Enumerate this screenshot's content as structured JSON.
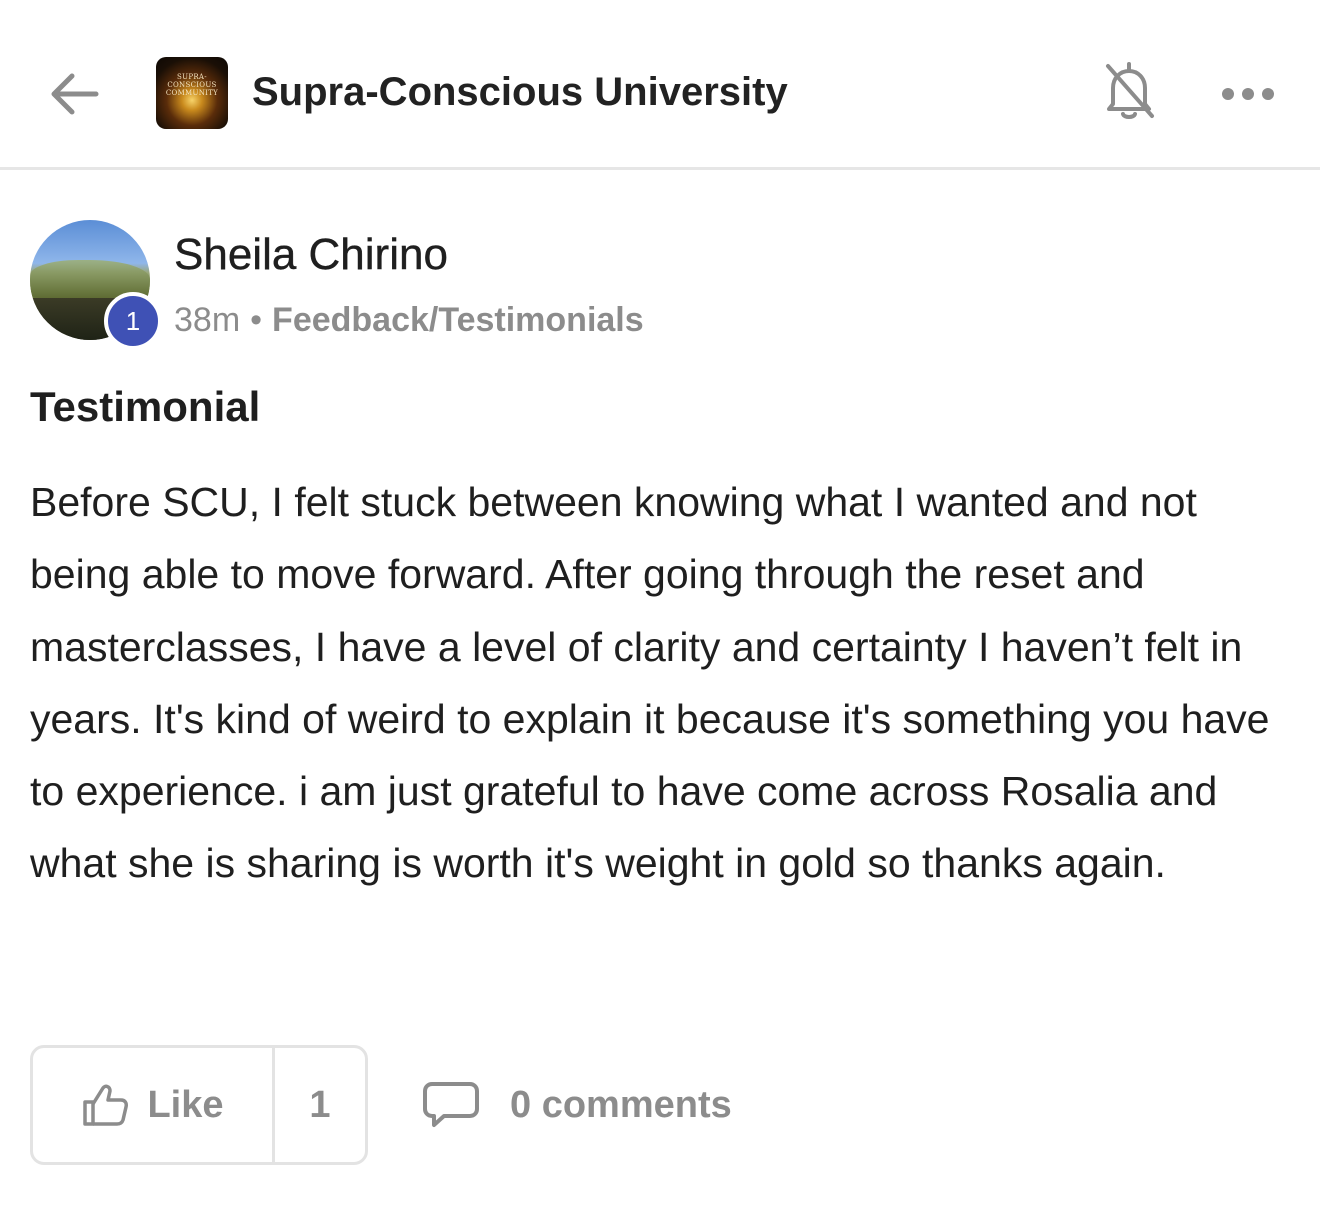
{
  "header": {
    "group_name": "Supra-Conscious University",
    "logo_text": "SUPRA-CONSCIOUS COMMUNITY",
    "back_icon": "arrow-left-icon",
    "bell_icon": "bell-off-icon",
    "more_icon": "more-horizontal-icon"
  },
  "post": {
    "author": {
      "name": "Sheila Chirino",
      "level": "1"
    },
    "time": "38m",
    "separator": "•",
    "category": "Feedback/Testimonials",
    "title": "Testimonial",
    "body": "Before SCU, I felt stuck between knowing what I wanted and not being able to move forward. After going through the reset and masterclasses, I have a level of clarity and certainty I haven’t felt in years. It's kind of weird to explain it because it's something you have to experience. i am just grateful to have come across Rosalia and what she is sharing is worth it's weight in gold so thanks again."
  },
  "actions": {
    "like_label": "Like",
    "like_count": "1",
    "comments_label": "0 comments"
  },
  "colors": {
    "text": "#1f1f1f",
    "muted": "#8c8c8c",
    "badge": "#3f51b5",
    "divider": "#e6e6e6"
  }
}
